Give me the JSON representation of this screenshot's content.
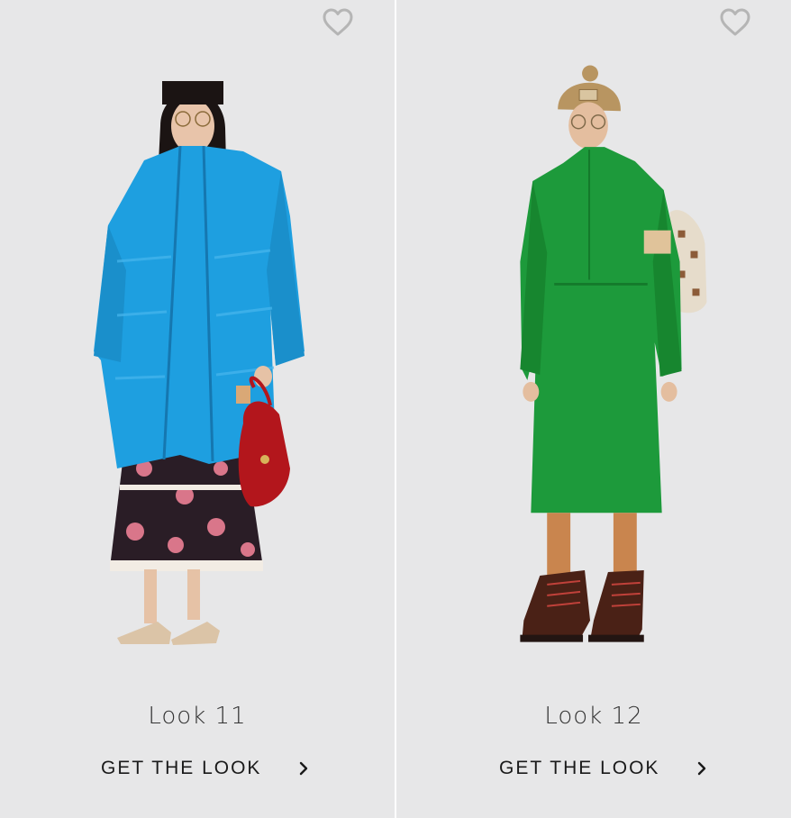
{
  "looks": [
    {
      "title": "Look 11",
      "cta_label": "GET THE LOOK",
      "coat_color": "#1e9fe0",
      "skirt_color": "#2a1d26",
      "bag_color": "#b3161c"
    },
    {
      "title": "Look 12",
      "cta_label": "GET THE LOOK",
      "coat_color": "#1d9a3b",
      "hat_color": "#b89561",
      "boot_color": "#4a2116"
    }
  ],
  "icons": {
    "favorite": "heart-icon",
    "chevron": "chevron-right-icon"
  }
}
